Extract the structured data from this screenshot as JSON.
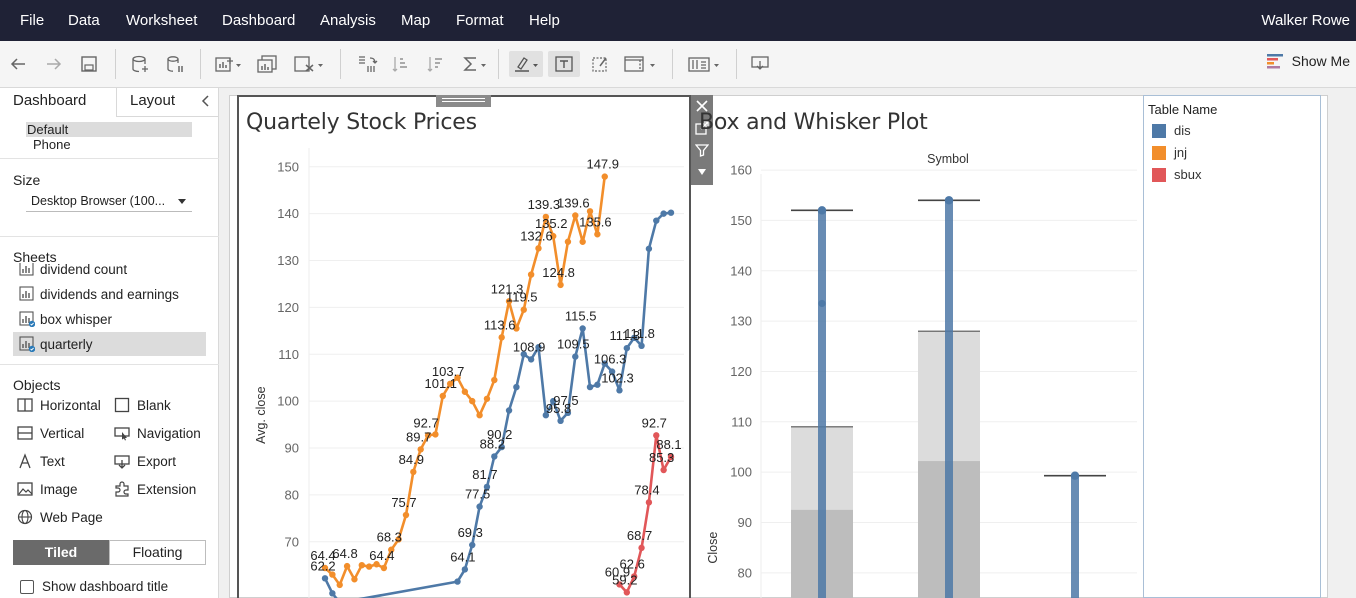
{
  "menu": {
    "items": [
      "File",
      "Data",
      "Worksheet",
      "Dashboard",
      "Analysis",
      "Map",
      "Format",
      "Help"
    ],
    "user": "Walker Rowe"
  },
  "toolbar": {
    "show_me": "Show Me",
    "icons": [
      "back-arrow-icon",
      "forward-arrow-icon",
      "save-icon",
      "new-data-source-icon",
      "pause-updates-icon",
      "new-worksheet-icon",
      "duplicate-sheet-icon",
      "clear-sheet-icon",
      "swap-rows-columns-icon",
      "sort-ascending-icon",
      "sort-descending-icon",
      "totals-icon",
      "highlight-icon",
      "show-mark-labels-icon",
      "format-workbook-icon",
      "fit-icon",
      "show-cards-icon",
      "presentation-icon"
    ]
  },
  "left_pane": {
    "tabs": [
      "Dashboard",
      "Layout"
    ],
    "collapse_icon": "chevron-left-icon",
    "devices": [
      "Default",
      "Phone"
    ],
    "size_label": "Size",
    "size_value": "Desktop Browser (100...",
    "sheets_label": "Sheets",
    "sheets": [
      {
        "name": "dividend count",
        "selected": false,
        "badge": false
      },
      {
        "name": "dividends and earnings",
        "selected": false,
        "badge": false
      },
      {
        "name": "box whisper",
        "selected": false,
        "badge": true
      },
      {
        "name": "quarterly",
        "selected": true,
        "badge": true
      }
    ],
    "objects_label": "Objects",
    "objects": [
      {
        "name": "Horizontal",
        "icon": "horizontal-container-icon"
      },
      {
        "name": "Blank",
        "icon": "blank-icon"
      },
      {
        "name": "Vertical",
        "icon": "vertical-container-icon"
      },
      {
        "name": "Navigation",
        "icon": "navigation-icon"
      },
      {
        "name": "Text",
        "icon": "text-icon"
      },
      {
        "name": "Export",
        "icon": "export-icon"
      },
      {
        "name": "Image",
        "icon": "image-icon"
      },
      {
        "name": "Extension",
        "icon": "extension-icon"
      },
      {
        "name": "Web Page",
        "icon": "web-page-icon"
      }
    ],
    "tiled": "Tiled",
    "floating": "Floating",
    "show_title": "Show dashboard title"
  },
  "colors": {
    "dis": "#4e79a7",
    "jnj": "#f28e2b",
    "sbux": "#e15759"
  },
  "legend": {
    "title": "Table Name",
    "items": [
      {
        "name": "dis",
        "color": "#4e79a7"
      },
      {
        "name": "jnj",
        "color": "#f28e2b"
      },
      {
        "name": "sbux",
        "color": "#e15759"
      }
    ]
  },
  "chart_data": [
    {
      "type": "line",
      "title": "Quartely Stock Prices",
      "ylabel": "Avg. close",
      "xlabel": "",
      "ylim": [
        58,
        154
      ],
      "yticks": [
        70,
        80,
        90,
        100,
        110,
        120,
        130,
        140,
        150
      ],
      "grid": true,
      "series": [
        {
          "name": "jnj",
          "color": "#f28e2b",
          "values": [
            {
              "q": 0,
              "v": 64.4,
              "label": "64.4"
            },
            {
              "q": 1,
              "v": 63.0
            },
            {
              "q": 2,
              "v": 60.8
            },
            {
              "q": 3,
              "v": 64.8,
              "label": "64.8"
            },
            {
              "q": 4,
              "v": 62.0
            },
            {
              "q": 5,
              "v": 65.0
            },
            {
              "q": 6,
              "v": 64.7
            },
            {
              "q": 7,
              "v": 65.2
            },
            {
              "q": 8,
              "v": 64.4,
              "label": "64.4"
            },
            {
              "q": 9,
              "v": 68.3,
              "label": "68.3"
            },
            {
              "q": 10,
              "v": 70.5
            },
            {
              "q": 11,
              "v": 75.7,
              "label": "75.7"
            },
            {
              "q": 12,
              "v": 84.9,
              "label": "84.9"
            },
            {
              "q": 13,
              "v": 89.7,
              "label": "89.7"
            },
            {
              "q": 14,
              "v": 92.7,
              "label": "92.7"
            },
            {
              "q": 15,
              "v": 92.9
            },
            {
              "q": 16,
              "v": 101.1,
              "label": "101.1"
            },
            {
              "q": 17,
              "v": 103.7,
              "label": "103.7"
            },
            {
              "q": 18,
              "v": 105.0
            },
            {
              "q": 19,
              "v": 102.0
            },
            {
              "q": 20,
              "v": 100.0
            },
            {
              "q": 21,
              "v": 97.0
            },
            {
              "q": 22,
              "v": 100.5
            },
            {
              "q": 23,
              "v": 104.5
            },
            {
              "q": 24,
              "v": 113.6,
              "label": "113.6"
            },
            {
              "q": 25,
              "v": 121.3,
              "label": "121.3"
            },
            {
              "q": 26,
              "v": 115.5
            },
            {
              "q": 27,
              "v": 119.5,
              "label": "119.5"
            },
            {
              "q": 28,
              "v": 127.0
            },
            {
              "q": 29,
              "v": 132.6,
              "label": "132.6"
            },
            {
              "q": 30,
              "v": 139.3,
              "label": "139.3"
            },
            {
              "q": 31,
              "v": 135.2,
              "label": "135.2"
            },
            {
              "q": 32,
              "v": 124.8,
              "label": "124.8"
            },
            {
              "q": 33,
              "v": 134.0
            },
            {
              "q": 34,
              "v": 139.6,
              "label": "139.6"
            },
            {
              "q": 35,
              "v": 134.0
            },
            {
              "q": 36,
              "v": 140.5
            },
            {
              "q": 37,
              "v": 135.6,
              "label": "135.6"
            },
            {
              "q": 38,
              "v": 147.9,
              "label": "147.9"
            }
          ]
        },
        {
          "name": "dis",
          "color": "#4e79a7",
          "values": [
            {
              "q": 0,
              "v": 62.2,
              "label": "62.2"
            },
            {
              "q": 1,
              "v": 59.0
            },
            {
              "q": 2,
              "v": 57.0
            },
            {
              "q": 18,
              "v": 61.5
            },
            {
              "q": 19,
              "v": 64.1,
              "label": "64.1"
            },
            {
              "q": 20,
              "v": 69.3,
              "label": "69.3"
            },
            {
              "q": 21,
              "v": 77.5,
              "label": "77.5"
            },
            {
              "q": 22,
              "v": 81.7,
              "label": "81.7"
            },
            {
              "q": 23,
              "v": 88.2,
              "label": "88.2"
            },
            {
              "q": 24,
              "v": 90.2,
              "label": "90.2"
            },
            {
              "q": 25,
              "v": 98.0
            },
            {
              "q": 26,
              "v": 103.0
            },
            {
              "q": 27,
              "v": 110.0
            },
            {
              "q": 28,
              "v": 108.9,
              "label": "108.9"
            },
            {
              "q": 29,
              "v": 111.5
            },
            {
              "q": 30,
              "v": 97.0
            },
            {
              "q": 31,
              "v": 100.0
            },
            {
              "q": 32,
              "v": 95.8,
              "label": "95.8"
            },
            {
              "q": 33,
              "v": 97.5,
              "label": "97.5"
            },
            {
              "q": 34,
              "v": 109.5,
              "label": "109.5"
            },
            {
              "q": 35,
              "v": 115.5,
              "label": "115.5"
            },
            {
              "q": 36,
              "v": 103.0
            },
            {
              "q": 37,
              "v": 103.5
            },
            {
              "q": 38,
              "v": 108.0
            },
            {
              "q": 39,
              "v": 106.3,
              "label": "106.3"
            },
            {
              "q": 40,
              "v": 102.3,
              "label": "102.3"
            },
            {
              "q": 41,
              "v": 111.3,
              "label": "111.3"
            },
            {
              "q": 42,
              "v": 113.5
            },
            {
              "q": 43,
              "v": 111.8,
              "label": "111.8"
            },
            {
              "q": 44,
              "v": 132.5
            },
            {
              "q": 45,
              "v": 138.5
            },
            {
              "q": 46,
              "v": 140.0
            },
            {
              "q": 47,
              "v": 140.2
            }
          ]
        },
        {
          "name": "sbux",
          "color": "#e15759",
          "values": [
            {
              "q": 40,
              "v": 60.9,
              "label": "60.9"
            },
            {
              "q": 41,
              "v": 59.2,
              "label": "59.2"
            },
            {
              "q": 42,
              "v": 62.6,
              "label": "62.6"
            },
            {
              "q": 43,
              "v": 68.7,
              "label": "68.7"
            },
            {
              "q": 44,
              "v": 78.4,
              "label": "78.4"
            },
            {
              "q": 45,
              "v": 92.7,
              "label": "92.7"
            },
            {
              "q": 46,
              "v": 85.3,
              "label": "85.3"
            },
            {
              "q": 47,
              "v": 88.1,
              "label": "88.1"
            }
          ]
        }
      ]
    },
    {
      "type": "box",
      "title": "Box and Whisker Plot",
      "xlabel": "Symbol",
      "ylabel": "Close",
      "ylim": [
        75,
        162
      ],
      "yticks": [
        80,
        90,
        100,
        110,
        120,
        130,
        140,
        150,
        160
      ],
      "grid": true,
      "boxes": [
        {
          "name": "dis",
          "whisker_high": 152.0,
          "upper_hinge": 109.0,
          "median": 92.5,
          "points_from": 75.0,
          "points_to": 152.0,
          "color": "#4e79a7"
        },
        {
          "name": "jnj",
          "whisker_high": 154.0,
          "upper_hinge": 128.0,
          "median": 102.2,
          "points_from": 75.0,
          "points_to": 154.0,
          "color": "#4e79a7"
        },
        {
          "name": "sbux",
          "whisker_high": 99.3,
          "upper_hinge": null,
          "median": null,
          "points_from": 75.0,
          "points_to": 99.3,
          "color": "#4e79a7"
        }
      ]
    }
  ]
}
